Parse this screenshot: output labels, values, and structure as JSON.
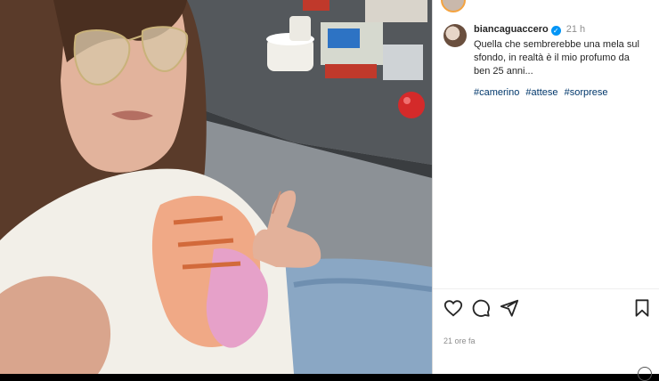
{
  "post": {
    "username": "biancaguaccero",
    "verified_mark": "✓",
    "time": "21 h",
    "caption": "Quella che sembrerebbe una mela sul sfondo, in realtà è il mio profumo da ben 25 anni...",
    "hashtags": [
      "#camerino",
      "#attese",
      "#sorprese"
    ],
    "posted_ago": "21 ore fa"
  },
  "icons": {
    "like": "heart-icon",
    "comment": "comment-icon",
    "share": "share-icon",
    "save": "bookmark-icon"
  },
  "colors": {
    "link": "#00376b",
    "verified": "#0095f6",
    "muted": "#8e8e8e"
  }
}
